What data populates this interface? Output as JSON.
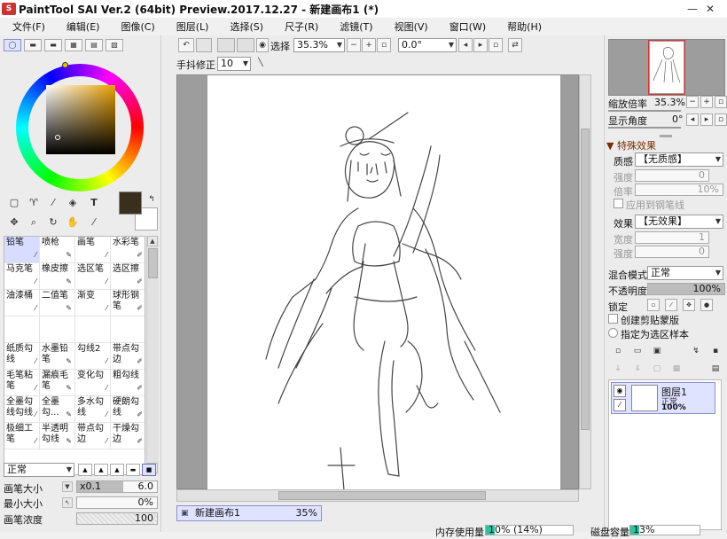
{
  "window": {
    "title": "PaintTool SAI Ver.2 (64bit) Preview.2017.12.27 - 新建画布1 (*)"
  },
  "menu": [
    "文件(F)",
    "编辑(E)",
    "图像(C)",
    "图层(L)",
    "选择(S)",
    "尺子(R)",
    "滤镜(T)",
    "视图(V)",
    "窗口(W)",
    "帮助(H)"
  ],
  "colors": {
    "primary": "#3a2f1c",
    "selected_hue": "#e8a000",
    "selection_bg": "#dfe3ff"
  },
  "brushes": [
    {
      "label": "铅笔",
      "selected": true
    },
    {
      "label": "喷枪"
    },
    {
      "label": "画笔"
    },
    {
      "label": "水彩笔"
    },
    {
      "label": "马克笔"
    },
    {
      "label": "橡皮擦"
    },
    {
      "label": "选区笔"
    },
    {
      "label": "选区擦"
    },
    {
      "label": "油漆桶"
    },
    {
      "label": "二值笔"
    },
    {
      "label": "渐变"
    },
    {
      "label": "球形钢笔"
    },
    {
      "label": ""
    },
    {
      "label": ""
    },
    {
      "label": ""
    },
    {
      "label": ""
    },
    {
      "label": "纸质勾线"
    },
    {
      "label": "水墨铅笔"
    },
    {
      "label": "勾线2"
    },
    {
      "label": "带点勾边"
    },
    {
      "label": "毛笔粘笔"
    },
    {
      "label": "漏痕毛笔"
    },
    {
      "label": "变化勾"
    },
    {
      "label": "粗勾线"
    },
    {
      "label": "全墨勾线勾线"
    },
    {
      "label": "全墨勾..."
    },
    {
      "label": "多水勾线"
    },
    {
      "label": "硬朗勾线"
    },
    {
      "label": "极细工笔"
    },
    {
      "label": "半透明勾线"
    },
    {
      "label": "带点勾边"
    },
    {
      "label": "干燥勾边"
    }
  ],
  "brush_settings": {
    "blend_mode": "正常",
    "size_label": "画笔大小",
    "size_mult": "x0.1",
    "size_value": "6.0",
    "min_size_label": "最小大小",
    "min_size_value": "0%",
    "density_label": "画笔浓度",
    "density_value": "100"
  },
  "toolbar": {
    "select_label": "选择",
    "zoom": "35.3%",
    "angle": "0.0°",
    "stabilizer_label": "手抖修正",
    "stabilizer_value": "10"
  },
  "document": {
    "tab_label": "新建画布1",
    "zoom": "35%"
  },
  "navigator": {
    "zoom_label": "缩放倍率",
    "zoom_value": "35.3%",
    "angle_label": "显示角度",
    "angle_value": "0°"
  },
  "effects": {
    "section_label": "特殊效果",
    "texture_label": "质感",
    "texture_value": "【无质感】",
    "strength_label": "强度",
    "strength_value": "0",
    "scale_label": "倍率",
    "scale_value": "10%",
    "apply_brush_label": "应用到钢笔线",
    "effect_label": "效果",
    "effect_value": "【无效果】",
    "width_label": "宽度",
    "width_value": "1",
    "effect_strength_label": "强度",
    "effect_strength_value": "0"
  },
  "layer_props": {
    "blend_label": "混合模式",
    "blend_value": "正常",
    "opacity_label": "不透明度",
    "opacity_value": "100%",
    "lock_label": "锁定",
    "clip_label": "创建剪贴蒙版",
    "sample_label": "指定为选区样本"
  },
  "layers": [
    {
      "name": "图层1",
      "mode": "正常",
      "opacity": "100%"
    }
  ],
  "status": {
    "memory_label": "内存使用量",
    "memory_value": "10% (14%)",
    "disk_label": "磁盘容量",
    "disk_value": "13%"
  }
}
